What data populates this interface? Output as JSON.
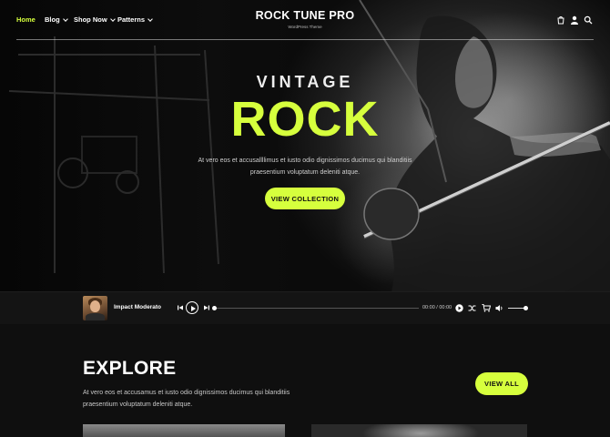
{
  "header": {
    "nav": [
      {
        "label": "Home",
        "active": true,
        "has_dropdown": false
      },
      {
        "label": "Blog",
        "active": false,
        "has_dropdown": true
      },
      {
        "label": "Shop Now",
        "active": false,
        "has_dropdown": true
      },
      {
        "label": "Patterns",
        "active": false,
        "has_dropdown": true
      }
    ],
    "brand_title": "ROCK TUNE PRO",
    "brand_subtitle": "WordPress Theme",
    "icons": [
      "cart-icon",
      "user-icon",
      "search-icon"
    ]
  },
  "hero": {
    "kicker": "VINTAGE",
    "headline": "ROCK",
    "description": "At vero eos et accusallllimus et iusto odio dignissimos ducimus qui blanditiis praesentium voluptatum deleniti atque.",
    "cta_label": "VIEW COLLECTION"
  },
  "player": {
    "track_title": "Impact Moderato",
    "time": "00:00 / 00:00",
    "progress": 0,
    "volume": 1.0,
    "icons": [
      "skip-back-icon",
      "play-icon",
      "skip-forward-icon",
      "play-small-icon",
      "shuffle-icon",
      "cart-add-icon",
      "volume-icon"
    ]
  },
  "explore": {
    "title": "EXPLORE",
    "description": "At vero eos et accusamus et iusto odio dignissimos ducimus qui blanditiis praesentium voluptatum deleniti atque.",
    "view_all_label": "VIEW ALL"
  },
  "colors": {
    "accent": "#d6ff3d",
    "background": "#0f0f0f",
    "player_bg": "#141414"
  }
}
